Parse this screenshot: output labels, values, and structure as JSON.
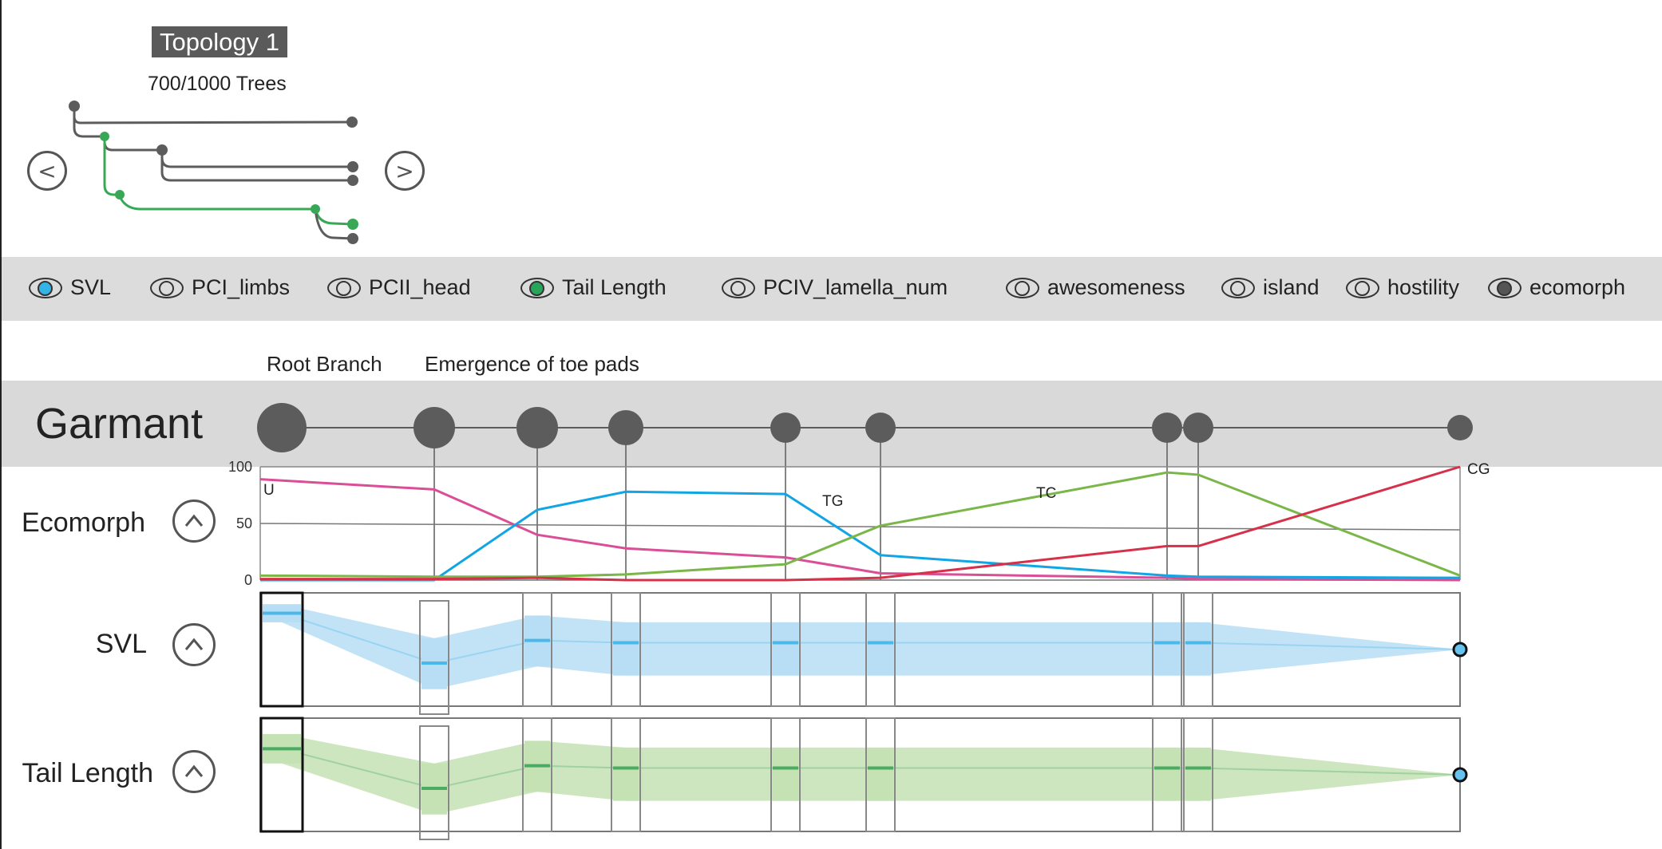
{
  "topology": {
    "title": "Topology 1",
    "tree_count": "700/1000 Trees",
    "prev_label": "<",
    "next_label": ">"
  },
  "attributes": [
    {
      "label": "SVL",
      "pupil_color": "#33b3e6",
      "active": true
    },
    {
      "label": "PCI_limbs",
      "pupil_color": "",
      "active": false
    },
    {
      "label": "PCII_head",
      "pupil_color": "",
      "active": false
    },
    {
      "label": "Tail Length",
      "pupil_color": "#27a558",
      "active": true
    },
    {
      "label": "PCIV_lamella_num",
      "pupil_color": "",
      "active": false
    },
    {
      "label": "awesomeness",
      "pupil_color": "",
      "active": false
    },
    {
      "label": "island",
      "pupil_color": "",
      "active": false
    },
    {
      "label": "hostility",
      "pupil_color": "",
      "active": false
    },
    {
      "label": "ecomorph",
      "pupil_color": "#555555",
      "active": true
    }
  ],
  "events": {
    "root_branch": "Root Branch",
    "toe_pads": "Emergence of toe pads"
  },
  "garmant": {
    "title": "Garmant"
  },
  "rows": {
    "ecomorph": "Ecomorph",
    "svl": "SVL",
    "tail": "Tail Length"
  },
  "colors": {
    "U": "#d94e97",
    "TG": "#11a6e3",
    "TC": "#7ab648",
    "CG": "#d6304a",
    "svl_band": "#cfe9f7",
    "svl_line": "#4cb8ea",
    "tail_band": "#d8ebcd",
    "tail_line": "#4aab63",
    "node": "#5c5c5c"
  },
  "chart_data": {
    "type": "line",
    "x": [
      1,
      2,
      3,
      4,
      5,
      6,
      7,
      8,
      9
    ],
    "ylim": [
      0,
      100
    ],
    "yticks": [
      "0",
      "50",
      "100"
    ],
    "series": [
      {
        "name": "U",
        "values": [
          89,
          80,
          40,
          28,
          20,
          6,
          2,
          1,
          0
        ]
      },
      {
        "name": "TG",
        "values": [
          0,
          0,
          62,
          78,
          76,
          22,
          4,
          3,
          2
        ]
      },
      {
        "name": "TC",
        "values": [
          4,
          3,
          3,
          5,
          14,
          48,
          95,
          93,
          4
        ]
      },
      {
        "name": "CG",
        "values": [
          1,
          1,
          2,
          0,
          0,
          2,
          30,
          30,
          100
        ]
      }
    ]
  },
  "svl_data": {
    "nodes": [
      {
        "mean": 0.18,
        "low": 0.1,
        "high": 0.26
      },
      {
        "mean": 0.62,
        "low": 0.4,
        "high": 0.85
      },
      {
        "mean": 0.42,
        "low": 0.2,
        "high": 0.65
      },
      {
        "mean": 0.44,
        "low": 0.26,
        "high": 0.73
      },
      {
        "mean": 0.44,
        "low": 0.26,
        "high": 0.73
      },
      {
        "mean": 0.44,
        "low": 0.26,
        "high": 0.73
      },
      {
        "mean": 0.44,
        "low": 0.26,
        "high": 0.73
      },
      {
        "mean": 0.44,
        "low": 0.26,
        "high": 0.73
      },
      {
        "mean": 0.5,
        "low": 0.5,
        "high": 0.5
      }
    ]
  },
  "tail_data": {
    "nodes": [
      {
        "mean": 0.27,
        "low": 0.14,
        "high": 0.4
      },
      {
        "mean": 0.62,
        "low": 0.4,
        "high": 0.85
      },
      {
        "mean": 0.42,
        "low": 0.2,
        "high": 0.65
      },
      {
        "mean": 0.44,
        "low": 0.26,
        "high": 0.73
      },
      {
        "mean": 0.44,
        "low": 0.26,
        "high": 0.73
      },
      {
        "mean": 0.44,
        "low": 0.26,
        "high": 0.73
      },
      {
        "mean": 0.44,
        "low": 0.26,
        "high": 0.73
      },
      {
        "mean": 0.44,
        "low": 0.26,
        "high": 0.73
      },
      {
        "mean": 0.5,
        "low": 0.5,
        "high": 0.5
      }
    ]
  }
}
